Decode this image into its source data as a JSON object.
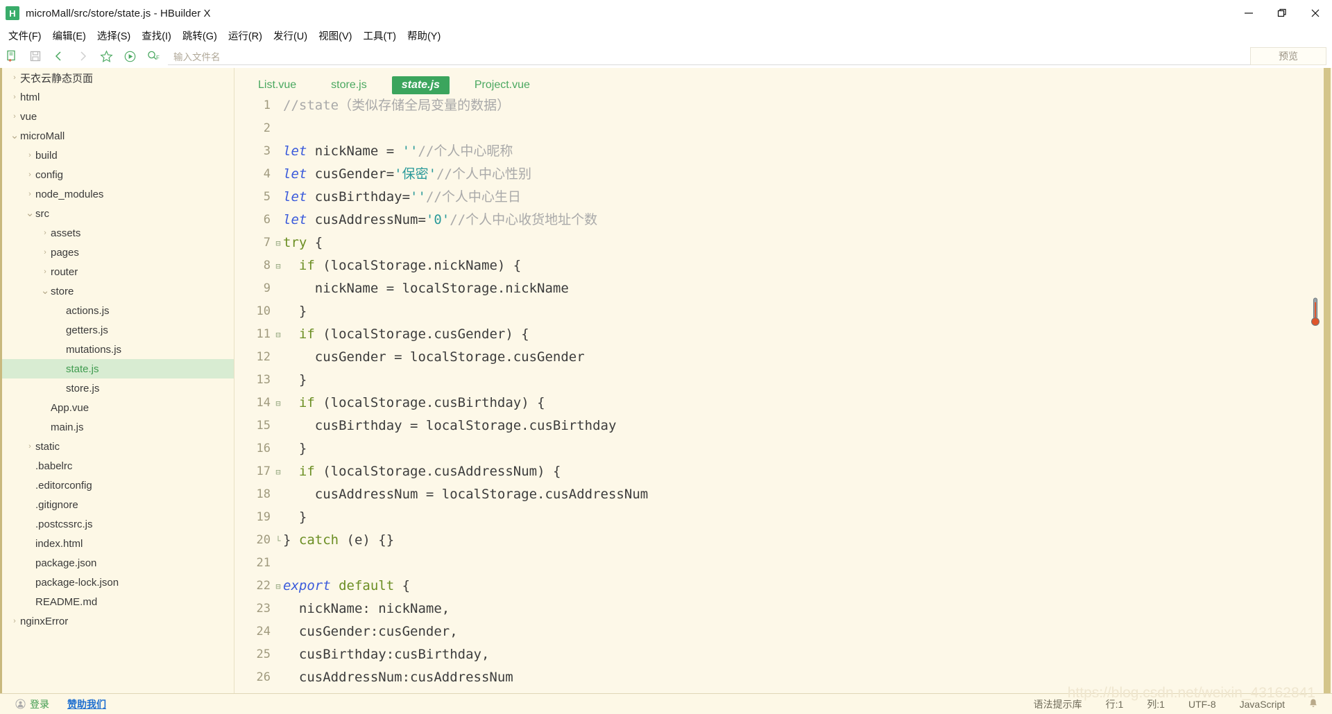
{
  "window": {
    "title": "microMall/src/store/state.js - HBuilder X",
    "logo_letter": "H",
    "minimize": "—",
    "maximize": "❐",
    "close": "✕"
  },
  "menubar": {
    "items": [
      {
        "label": "文件(F)"
      },
      {
        "label": "编辑(E)"
      },
      {
        "label": "选择(S)"
      },
      {
        "label": "查找(I)"
      },
      {
        "label": "跳转(G)"
      },
      {
        "label": "运行(R)"
      },
      {
        "label": "发行(U)"
      },
      {
        "label": "视图(V)"
      },
      {
        "label": "工具(T)"
      },
      {
        "label": "帮助(Y)"
      }
    ]
  },
  "toolbar": {
    "icons": [
      {
        "name": "new-file-icon"
      },
      {
        "name": "save-icon"
      },
      {
        "name": "back-arrow-icon"
      },
      {
        "name": "forward-arrow-icon"
      },
      {
        "name": "star-icon"
      },
      {
        "name": "run-icon"
      },
      {
        "name": "search-file-icon"
      }
    ],
    "search_placeholder": "输入文件名",
    "preview_label": "预览"
  },
  "sidebar": {
    "items": [
      {
        "label": "天衣云静态页面",
        "indent": 0,
        "arrow": "collapsed",
        "selected": false
      },
      {
        "label": "html",
        "indent": 0,
        "arrow": "collapsed",
        "selected": false
      },
      {
        "label": "vue",
        "indent": 0,
        "arrow": "collapsed",
        "selected": false
      },
      {
        "label": "microMall",
        "indent": 0,
        "arrow": "expanded",
        "selected": false
      },
      {
        "label": "build",
        "indent": 1,
        "arrow": "collapsed",
        "selected": false
      },
      {
        "label": "config",
        "indent": 1,
        "arrow": "collapsed",
        "selected": false
      },
      {
        "label": "node_modules",
        "indent": 1,
        "arrow": "collapsed",
        "selected": false
      },
      {
        "label": "src",
        "indent": 1,
        "arrow": "expanded",
        "selected": false
      },
      {
        "label": "assets",
        "indent": 2,
        "arrow": "collapsed",
        "selected": false
      },
      {
        "label": "pages",
        "indent": 2,
        "arrow": "collapsed",
        "selected": false
      },
      {
        "label": "router",
        "indent": 2,
        "arrow": "collapsed",
        "selected": false
      },
      {
        "label": "store",
        "indent": 2,
        "arrow": "expanded",
        "selected": false
      },
      {
        "label": "actions.js",
        "indent": 3,
        "arrow": "none",
        "selected": false
      },
      {
        "label": "getters.js",
        "indent": 3,
        "arrow": "none",
        "selected": false
      },
      {
        "label": "mutations.js",
        "indent": 3,
        "arrow": "none",
        "selected": false
      },
      {
        "label": "state.js",
        "indent": 3,
        "arrow": "none",
        "selected": true
      },
      {
        "label": "store.js",
        "indent": 3,
        "arrow": "none",
        "selected": false
      },
      {
        "label": "App.vue",
        "indent": 2,
        "arrow": "none",
        "selected": false
      },
      {
        "label": "main.js",
        "indent": 2,
        "arrow": "none",
        "selected": false
      },
      {
        "label": "static",
        "indent": 1,
        "arrow": "collapsed",
        "selected": false
      },
      {
        "label": ".babelrc",
        "indent": 1,
        "arrow": "none",
        "selected": false
      },
      {
        "label": ".editorconfig",
        "indent": 1,
        "arrow": "none",
        "selected": false
      },
      {
        "label": ".gitignore",
        "indent": 1,
        "arrow": "none",
        "selected": false
      },
      {
        "label": ".postcssrc.js",
        "indent": 1,
        "arrow": "none",
        "selected": false
      },
      {
        "label": "index.html",
        "indent": 1,
        "arrow": "none",
        "selected": false
      },
      {
        "label": "package.json",
        "indent": 1,
        "arrow": "none",
        "selected": false
      },
      {
        "label": "package-lock.json",
        "indent": 1,
        "arrow": "none",
        "selected": false
      },
      {
        "label": "README.md",
        "indent": 1,
        "arrow": "none",
        "selected": false
      },
      {
        "label": "nginxError",
        "indent": 0,
        "arrow": "collapsed",
        "selected": false
      }
    ]
  },
  "editor": {
    "tabs": [
      {
        "label": "List.vue",
        "active": false
      },
      {
        "label": "store.js",
        "active": false
      },
      {
        "label": "state.js",
        "active": true
      },
      {
        "label": "Project.vue",
        "active": false
      }
    ],
    "lines": [
      {
        "num": "1",
        "fold": "",
        "tokens": [
          {
            "t": "//state（类似存储全局变量的数据）",
            "c": "cmt"
          }
        ]
      },
      {
        "num": "2",
        "fold": "",
        "tokens": [
          {
            "t": "",
            "c": "code"
          }
        ]
      },
      {
        "num": "3",
        "fold": "",
        "tokens": [
          {
            "t": "let",
            "c": "kw"
          },
          {
            "t": " nickName = ",
            "c": ""
          },
          {
            "t": "''",
            "c": "str"
          },
          {
            "t": "//个人中心昵称",
            "c": "cmt"
          }
        ]
      },
      {
        "num": "4",
        "fold": "",
        "tokens": [
          {
            "t": "let",
            "c": "kw"
          },
          {
            "t": " cusGender=",
            "c": ""
          },
          {
            "t": "'保密'",
            "c": "str"
          },
          {
            "t": "//个人中心性别",
            "c": "cmt"
          }
        ]
      },
      {
        "num": "5",
        "fold": "",
        "tokens": [
          {
            "t": "let",
            "c": "kw"
          },
          {
            "t": " cusBirthday=",
            "c": ""
          },
          {
            "t": "''",
            "c": "str"
          },
          {
            "t": "//个人中心生日",
            "c": "cmt"
          }
        ]
      },
      {
        "num": "6",
        "fold": "",
        "tokens": [
          {
            "t": "let",
            "c": "kw"
          },
          {
            "t": " cusAddressNum=",
            "c": ""
          },
          {
            "t": "'0'",
            "c": "str"
          },
          {
            "t": "//个人中心收货地址个数",
            "c": "cmt"
          }
        ]
      },
      {
        "num": "7",
        "fold": "⊟",
        "tokens": [
          {
            "t": "try",
            "c": "kw2"
          },
          {
            "t": " {",
            "c": ""
          }
        ]
      },
      {
        "num": "8",
        "fold": "⊟",
        "tokens": [
          {
            "t": "  ",
            "c": ""
          },
          {
            "t": "if",
            "c": "kw2"
          },
          {
            "t": " (localStorage.nickName) {",
            "c": ""
          }
        ]
      },
      {
        "num": "9",
        "fold": "",
        "tokens": [
          {
            "t": "    nickName = localStorage.nickName",
            "c": ""
          }
        ]
      },
      {
        "num": "10",
        "fold": "",
        "tokens": [
          {
            "t": "  }",
            "c": ""
          }
        ]
      },
      {
        "num": "11",
        "fold": "⊟",
        "tokens": [
          {
            "t": "  ",
            "c": ""
          },
          {
            "t": "if",
            "c": "kw2"
          },
          {
            "t": " (localStorage.cusGender) {",
            "c": ""
          }
        ]
      },
      {
        "num": "12",
        "fold": "",
        "tokens": [
          {
            "t": "    cusGender = localStorage.cusGender",
            "c": ""
          }
        ]
      },
      {
        "num": "13",
        "fold": "",
        "tokens": [
          {
            "t": "  }",
            "c": ""
          }
        ]
      },
      {
        "num": "14",
        "fold": "⊟",
        "tokens": [
          {
            "t": "  ",
            "c": ""
          },
          {
            "t": "if",
            "c": "kw2"
          },
          {
            "t": " (localStorage.cusBirthday) {",
            "c": ""
          }
        ]
      },
      {
        "num": "15",
        "fold": "",
        "tokens": [
          {
            "t": "    cusBirthday = localStorage.cusBirthday",
            "c": ""
          }
        ]
      },
      {
        "num": "16",
        "fold": "",
        "tokens": [
          {
            "t": "  }",
            "c": ""
          }
        ]
      },
      {
        "num": "17",
        "fold": "⊟",
        "tokens": [
          {
            "t": "  ",
            "c": ""
          },
          {
            "t": "if",
            "c": "kw2"
          },
          {
            "t": " (localStorage.cusAddressNum) {",
            "c": ""
          }
        ]
      },
      {
        "num": "18",
        "fold": "",
        "tokens": [
          {
            "t": "    cusAddressNum = localStorage.cusAddressNum",
            "c": ""
          }
        ]
      },
      {
        "num": "19",
        "fold": "",
        "tokens": [
          {
            "t": "  }",
            "c": ""
          }
        ]
      },
      {
        "num": "20",
        "fold": "└",
        "tokens": [
          {
            "t": "} ",
            "c": ""
          },
          {
            "t": "catch",
            "c": "kw2"
          },
          {
            "t": " (e) {}",
            "c": ""
          }
        ]
      },
      {
        "num": "21",
        "fold": "",
        "tokens": [
          {
            "t": "",
            "c": ""
          }
        ]
      },
      {
        "num": "22",
        "fold": "⊟",
        "tokens": [
          {
            "t": "export",
            "c": "kw"
          },
          {
            "t": " ",
            "c": ""
          },
          {
            "t": "default",
            "c": "kw2"
          },
          {
            "t": " {",
            "c": ""
          }
        ]
      },
      {
        "num": "23",
        "fold": "",
        "tokens": [
          {
            "t": "  nickName: nickName,",
            "c": ""
          }
        ]
      },
      {
        "num": "24",
        "fold": "",
        "tokens": [
          {
            "t": "  cusGender:cusGender,",
            "c": ""
          }
        ]
      },
      {
        "num": "25",
        "fold": "",
        "tokens": [
          {
            "t": "  cusBirthday:cusBirthday,",
            "c": ""
          }
        ]
      },
      {
        "num": "26",
        "fold": "",
        "tokens": [
          {
            "t": "  cusAddressNum:cusAddressNum",
            "c": ""
          }
        ]
      }
    ]
  },
  "statusbar": {
    "login_label": "登录",
    "sponsor_label": "赞助我们",
    "syntax_label": "语法提示库",
    "line_label": "行:1",
    "column_label": "列:1",
    "encoding": "UTF-8",
    "language": "JavaScript",
    "bell": "ὑ4"
  },
  "watermark": "https://blog.csdn.net/weixin_43162841",
  "colors": {
    "accent_green": "#3ba55d",
    "sidebar_bg": "#fdf8e6",
    "editor_bg": "#fdf8e8",
    "selection_bg": "#d8ecd2",
    "scrollbar": "#d4c58a"
  }
}
